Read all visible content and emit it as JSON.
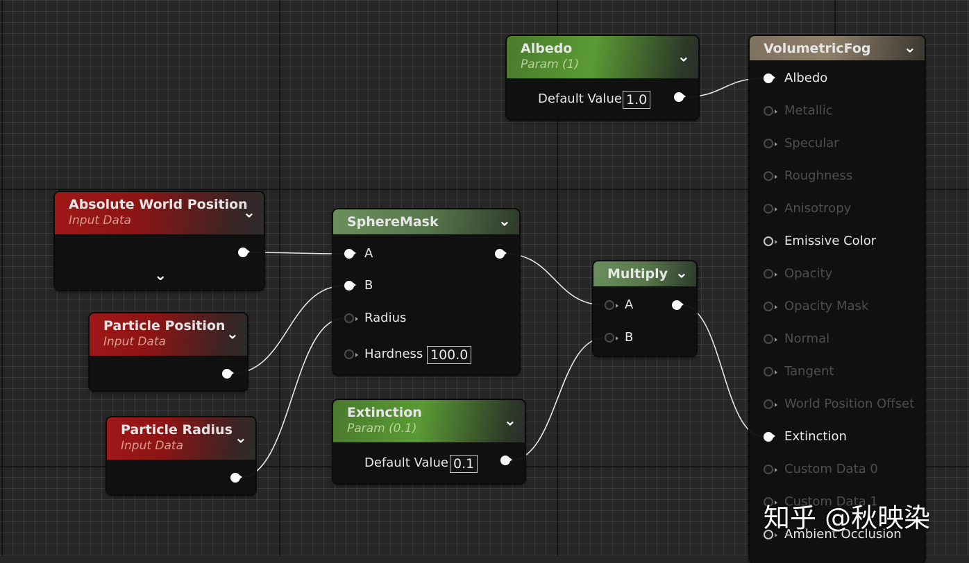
{
  "nodes": {
    "albedo": {
      "title": "Albedo",
      "subtitle": "Param (1)",
      "default_label": "Default Value",
      "default_value": "1.0"
    },
    "extinction": {
      "title": "Extinction",
      "subtitle": "Param (0.1)",
      "default_label": "Default Value",
      "default_value": "0.1"
    },
    "awp": {
      "title": "Absolute World Position",
      "subtitle": "Input Data"
    },
    "particle_position": {
      "title": "Particle Position",
      "subtitle": "Input Data"
    },
    "particle_radius": {
      "title": "Particle Radius",
      "subtitle": "Input Data"
    },
    "spheremask": {
      "title": "SphereMask",
      "pins": [
        "A",
        "B",
        "Radius",
        "Hardness"
      ],
      "hardness_value": "100.0"
    },
    "multiply": {
      "title": "Multiply",
      "pins": [
        "A",
        "B"
      ]
    },
    "volumetric_fog": {
      "title": "VolumetricFog",
      "pins": [
        {
          "label": "Albedo",
          "state": "connected"
        },
        {
          "label": "Metallic",
          "state": "disabled"
        },
        {
          "label": "Specular",
          "state": "disabled"
        },
        {
          "label": "Roughness",
          "state": "disabled"
        },
        {
          "label": "Anisotropy",
          "state": "disabled"
        },
        {
          "label": "Emissive Color",
          "state": "enabled"
        },
        {
          "label": "Opacity",
          "state": "disabled"
        },
        {
          "label": "Opacity Mask",
          "state": "disabled"
        },
        {
          "label": "Normal",
          "state": "disabled"
        },
        {
          "label": "Tangent",
          "state": "disabled"
        },
        {
          "label": "World Position Offset",
          "state": "disabled"
        },
        {
          "label": "Extinction",
          "state": "connected"
        },
        {
          "label": "Custom Data 0",
          "state": "disabled"
        },
        {
          "label": "Custom Data 1",
          "state": "disabled"
        },
        {
          "label": "Ambient Occlusion",
          "state": "enabled"
        }
      ]
    }
  },
  "icons": {
    "collapse": "chevron-down-icon",
    "pin": "pin-circle-icon"
  },
  "colors": {
    "input_header": "#a01818",
    "param_header": "#5a9a34",
    "function_header": "#6a8f5c",
    "output_header": "#8f806b",
    "background": "#262626"
  },
  "watermark": "知乎 @秋映染"
}
